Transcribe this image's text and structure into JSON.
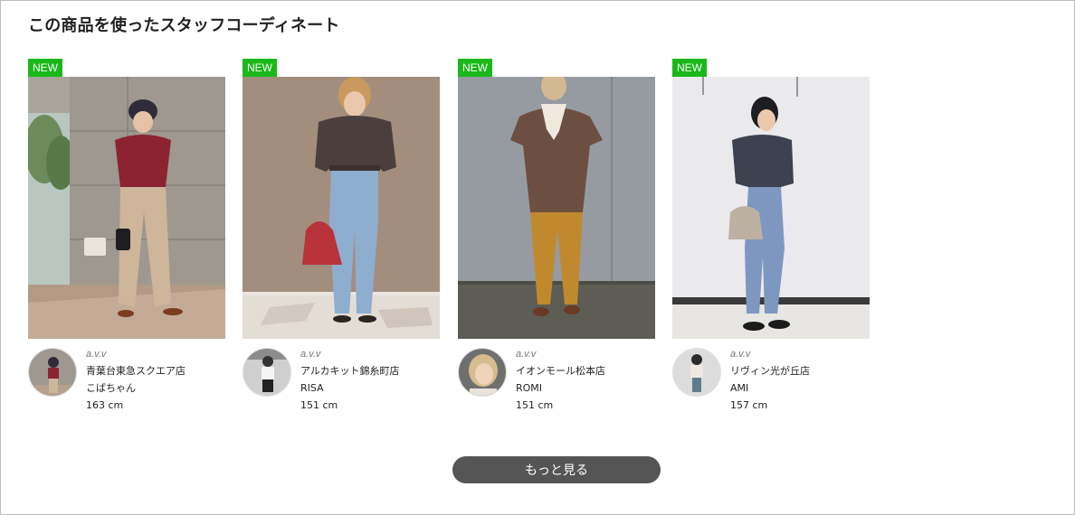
{
  "section": {
    "title": "この商品を使ったスタッフコーディネート"
  },
  "colors": {
    "badge": "#1ab81a",
    "button_bg": "#555555"
  },
  "cards": [
    {
      "badge": "NEW",
      "brand": "a.v.v",
      "shop": "青葉台東急スクエア店",
      "staff": "こばちゃん",
      "height": "163 cm"
    },
    {
      "badge": "NEW",
      "brand": "a.v.v",
      "shop": "アルカキット錦糸町店",
      "staff": "RISA",
      "height": "151 cm"
    },
    {
      "badge": "NEW",
      "brand": "a.v.v",
      "shop": "イオンモール松本店",
      "staff": "ROMI",
      "height": "151 cm"
    },
    {
      "badge": "NEW",
      "brand": "a.v.v",
      "shop": "リヴィン光が丘店",
      "staff": "AMI",
      "height": "157 cm"
    }
  ],
  "more_button": {
    "label": "もっと見る"
  }
}
